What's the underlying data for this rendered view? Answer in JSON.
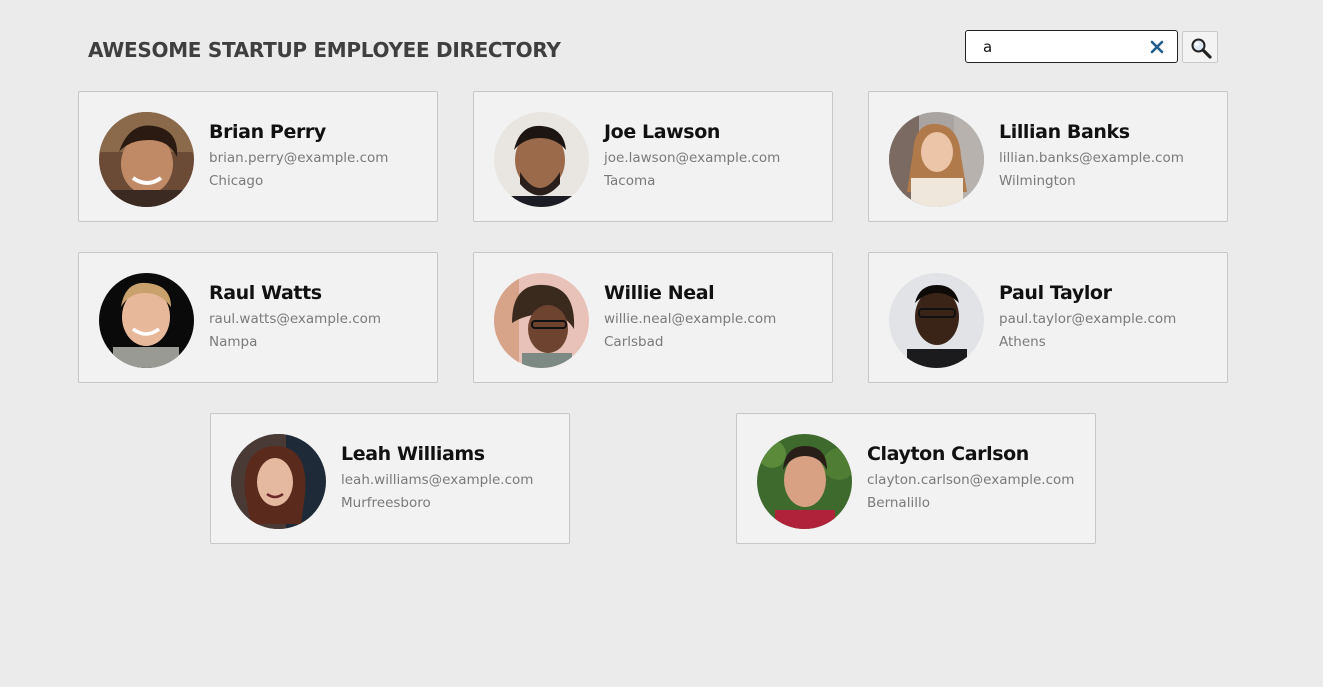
{
  "header": {
    "title": "AWESOME STARTUP EMPLOYEE DIRECTORY"
  },
  "search": {
    "value": "a",
    "clear_icon": "close-icon",
    "button_icon": "magnifier-icon",
    "clear_color": "#1f5d8c"
  },
  "employees": [
    {
      "name": "Brian Perry",
      "email": "brian.perry@example.com",
      "city": "Chicago"
    },
    {
      "name": "Joe Lawson",
      "email": "joe.lawson@example.com",
      "city": "Tacoma"
    },
    {
      "name": "Lillian Banks",
      "email": "lillian.banks@example.com",
      "city": "Wilmington"
    },
    {
      "name": "Raul Watts",
      "email": "raul.watts@example.com",
      "city": "Nampa"
    },
    {
      "name": "Willie Neal",
      "email": "willie.neal@example.com",
      "city": "Carlsbad"
    },
    {
      "name": "Paul Taylor",
      "email": "paul.taylor@example.com",
      "city": "Athens"
    },
    {
      "name": "Leah Williams",
      "email": "leah.williams@example.com",
      "city": "Murfreesboro"
    },
    {
      "name": "Clayton Carlson",
      "email": "clayton.carlson@example.com",
      "city": "Bernalillo"
    }
  ]
}
